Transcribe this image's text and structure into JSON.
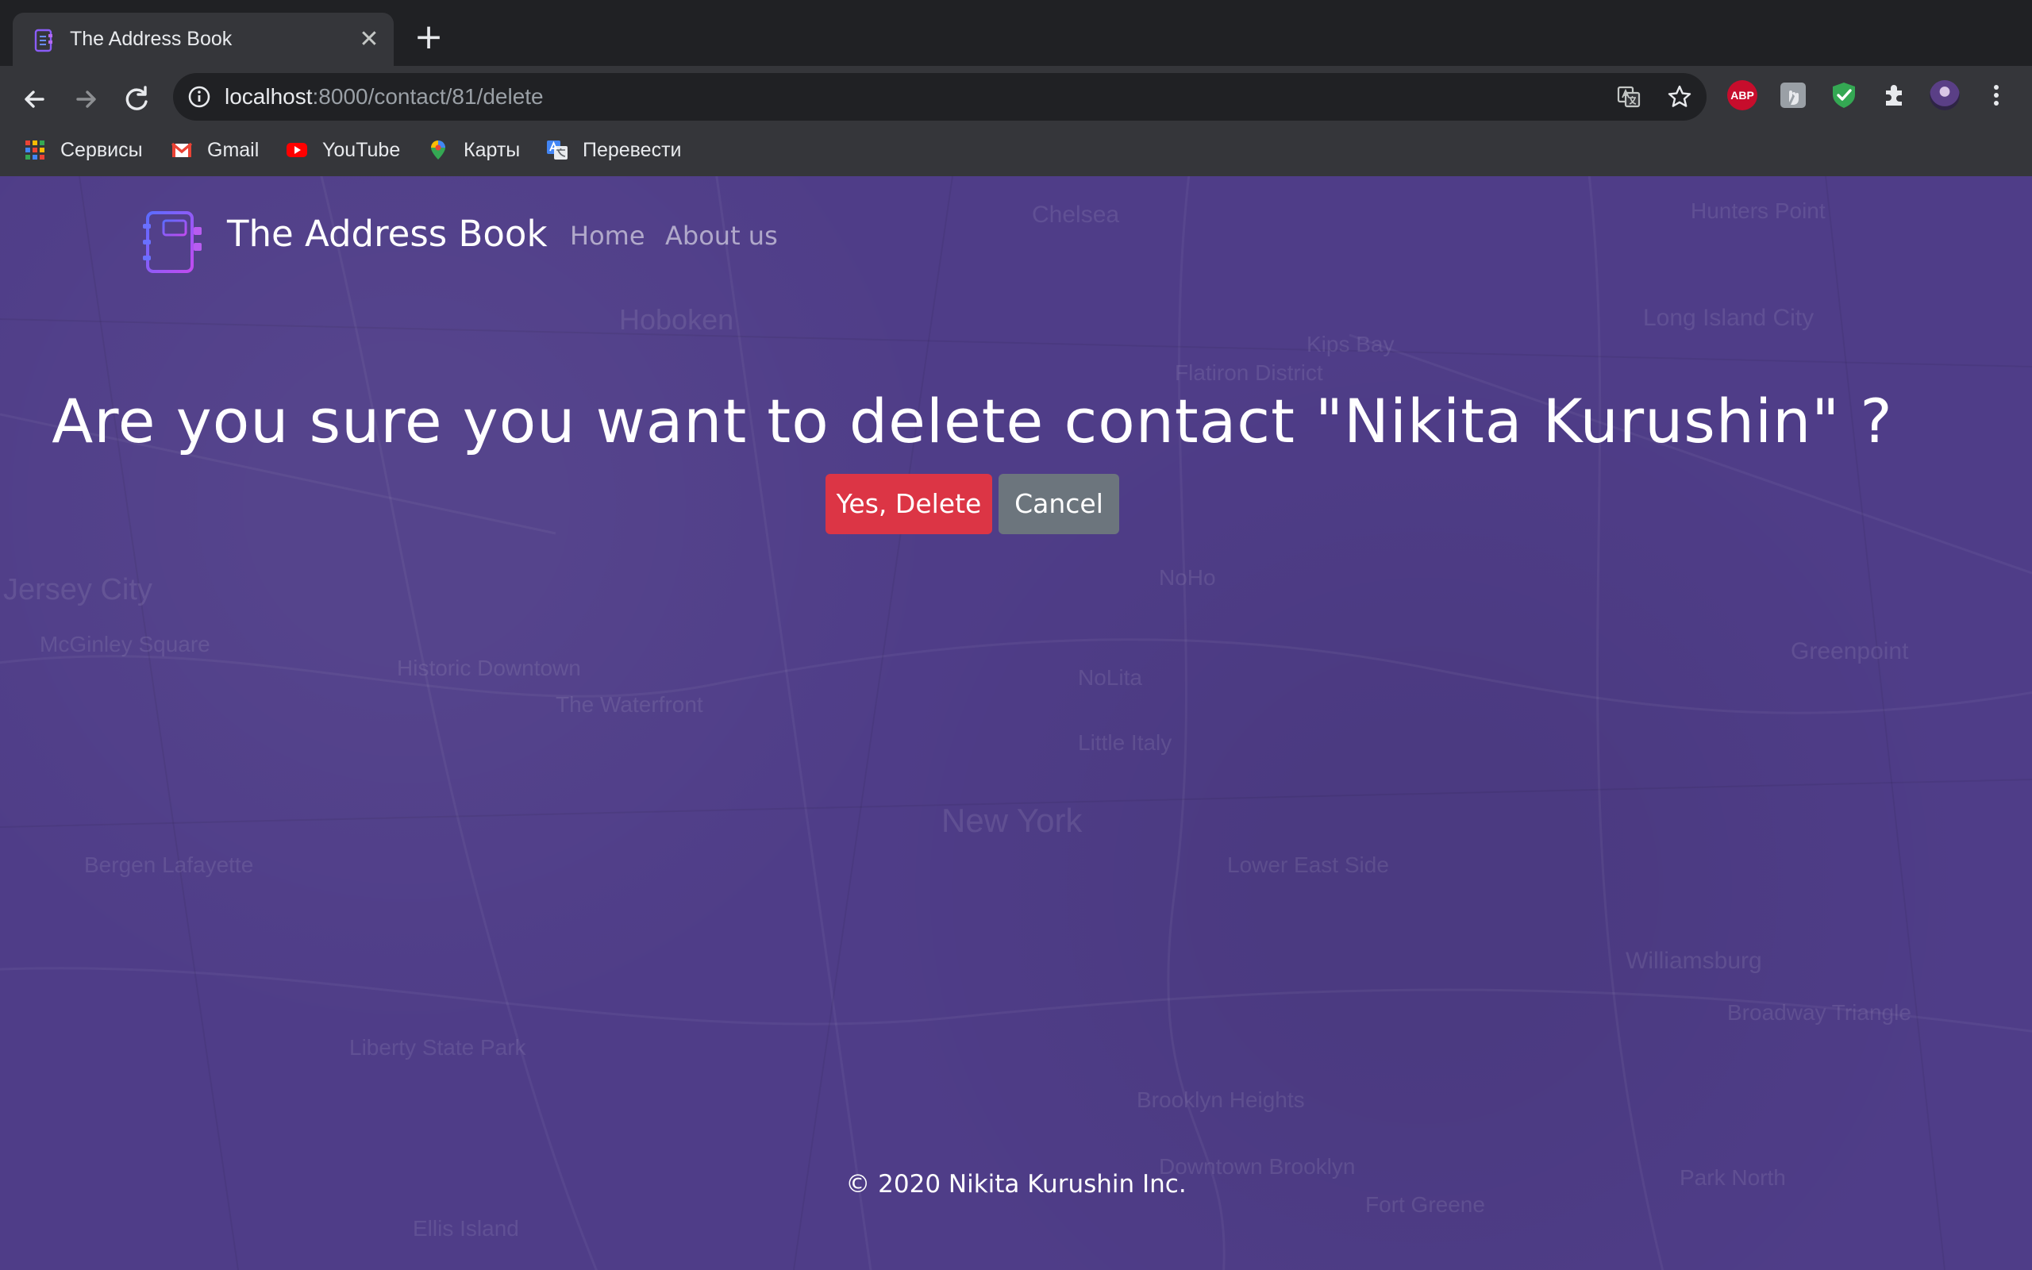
{
  "browser": {
    "tab": {
      "title": "The Address Book",
      "close": "✕"
    },
    "new_tab": "+",
    "url": {
      "host": "localhost",
      "path": ":8000/contact/81/delete"
    },
    "extensions": {
      "abp": "ABP"
    },
    "bookmarks": [
      {
        "label": "Сервисы",
        "icon": "apps-grid-icon"
      },
      {
        "label": "Gmail",
        "icon": "gmail-icon"
      },
      {
        "label": "YouTube",
        "icon": "youtube-icon"
      },
      {
        "label": "Карты",
        "icon": "maps-pin-icon"
      },
      {
        "label": "Перевести",
        "icon": "translate-icon"
      }
    ]
  },
  "site": {
    "brand": "The Address Book",
    "nav": [
      {
        "label": "Home"
      },
      {
        "label": "About us"
      }
    ]
  },
  "main": {
    "question": "Are you sure you want to delete contact \"Nikita Kurushin\" ?",
    "confirm_label": "Yes, Delete",
    "cancel_label": "Cancel"
  },
  "footer": {
    "text": "© 2020 Nikita Kurushin Inc."
  },
  "map_labels": [
    "Hoboken",
    "Chelsea",
    "Jersey City",
    "Historic Downtown",
    "The Waterfront",
    "NoLita",
    "Little Italy",
    "New York",
    "Lower East Side",
    "Williamsburg",
    "Greenpoint",
    "Long Island City",
    "Kips Bay",
    "Flatiron District",
    "Brooklyn Heights",
    "Downtown Brooklyn",
    "Fort Greene",
    "Hunters Point",
    "Liberty State Park",
    "Bergen Lafayette",
    "McGinley Square",
    "Ellis Island",
    "NoHo",
    "Park North",
    "Broadway Triangle"
  ],
  "colors": {
    "page_bg": "#4f3d88",
    "danger": "#dc3545",
    "secondary": "#6c757d",
    "chrome_dark": "#202124",
    "chrome_toolbar": "#35363a"
  }
}
